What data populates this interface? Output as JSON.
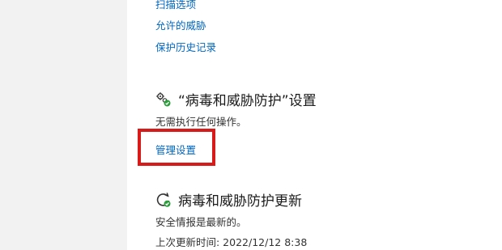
{
  "links": {
    "scan_options": "扫描选项",
    "allowed_threats": "允许的威胁",
    "protection_history": "保护历史记录"
  },
  "settings_section": {
    "title": "“病毒和威胁防护”设置",
    "description": "无需执行任何操作。",
    "manage_link": "管理设置",
    "icon": "gears-check-icon"
  },
  "updates_section": {
    "title": "病毒和威胁防护更新",
    "description": "安全情报是最新的。",
    "last_update": "上次更新时间: 2022/12/12 8:38",
    "icon": "refresh-check-icon"
  },
  "colors": {
    "link": "#0067c0",
    "status_ok": "#2a9d3a",
    "highlight": "#d71a1a"
  }
}
